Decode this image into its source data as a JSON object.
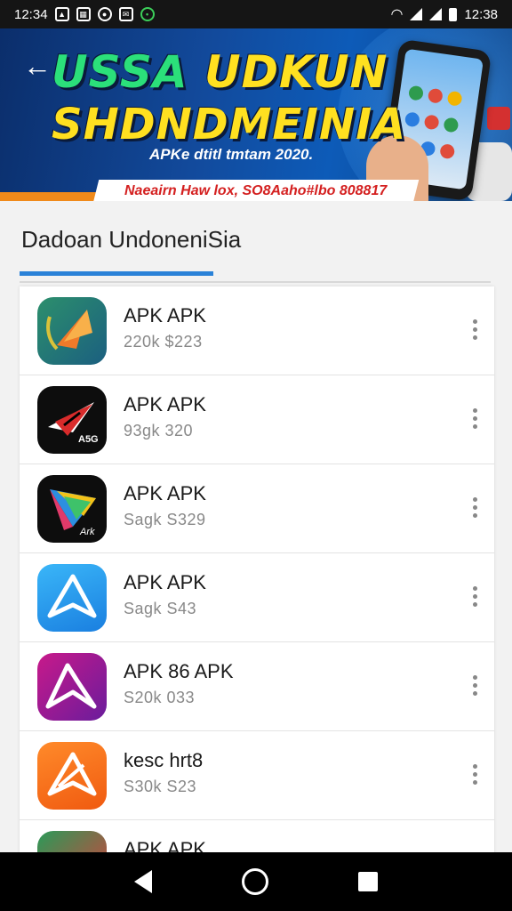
{
  "status_bar": {
    "time_left": "12:34",
    "time_right": "12:38",
    "icons": [
      "image-icon",
      "grid-icon",
      "circle-icon",
      "mail-icon",
      "leaf-icon",
      "wifi-icon",
      "signal-icon",
      "signal-icon",
      "battery-icon"
    ]
  },
  "banner": {
    "headline_part1": "USSA ",
    "headline_part2": "UDKUN",
    "headline_line2": "SHDNDMEINIA",
    "subtitle": "APKe dtitl tmtam 2020.",
    "ribbon": "Naeairn Haw lox, SO8Aaho#lbo 808817",
    "colors": {
      "green": "#2be07a",
      "yellow": "#ffe020",
      "ribbon_red": "#d42020"
    }
  },
  "section": {
    "title": "Dadoan UndoneniSia"
  },
  "apps": [
    {
      "name": "APK APK",
      "meta": "220k $223",
      "icon": "orange-kite-icon",
      "icon_label": ""
    },
    {
      "name": "APK APK",
      "meta": "93gk 320",
      "icon": "red-paper-plane-icon",
      "icon_label": "A5G"
    },
    {
      "name": "APK APK",
      "meta": "Sagk S329",
      "icon": "rainbow-arrow-icon",
      "icon_label": "Ark"
    },
    {
      "name": "APK APK",
      "meta": "Sagk S43",
      "icon": "blue-a-logo-icon",
      "icon_label": ""
    },
    {
      "name": "APK 86 APK",
      "meta": "S20k 033",
      "icon": "purple-a-logo-icon",
      "icon_label": ""
    },
    {
      "name": "kesc hrt8",
      "meta": "S30k S23",
      "icon": "orange-a-logo-icon",
      "icon_label": ""
    },
    {
      "name": "APK APK",
      "meta": "",
      "icon": "colorful-logo-icon",
      "icon_label": ""
    }
  ],
  "nav": {
    "icons": [
      "back-icon",
      "home-icon",
      "recents-icon"
    ]
  }
}
